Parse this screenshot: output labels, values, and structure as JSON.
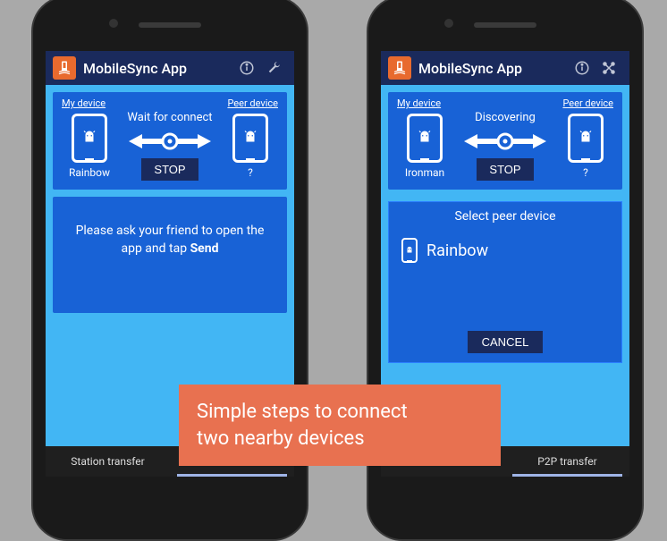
{
  "app": {
    "title": "MobileSync App"
  },
  "panel": {
    "my_device_label": "My device",
    "peer_device_label": "Peer device",
    "stop_label": "STOP"
  },
  "tabs": {
    "station": "Station transfer",
    "p2p": "P2P transfer"
  },
  "left_screen": {
    "status": "Wait for connect",
    "my_name": "Rainbow",
    "peer_name": "?",
    "message_prefix": "Please ask your friend to open the app and tap ",
    "message_bold": "Send"
  },
  "right_screen": {
    "status": "Discovering",
    "my_name": "Ironman",
    "peer_name": "?"
  },
  "dialog": {
    "title": "Select peer device",
    "item0": "Rainbow",
    "cancel": "CANCEL"
  },
  "caption": {
    "line1": "Simple steps to connect",
    "line2": "two nearby devices"
  },
  "colors": {
    "primary": "#1862d6",
    "dark": "#1a2a5c",
    "accent": "#e87150",
    "bg": "#42b6f4"
  }
}
